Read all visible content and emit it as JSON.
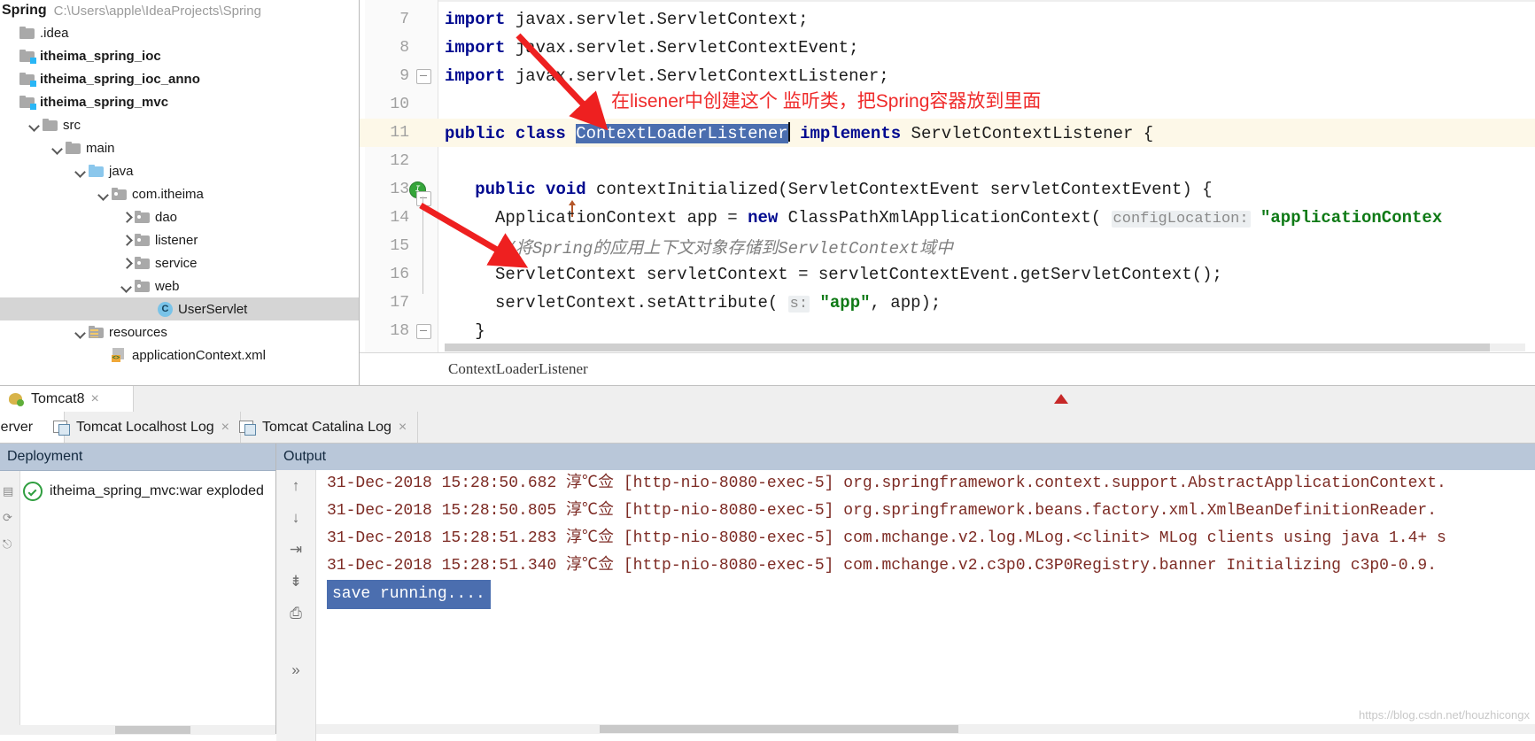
{
  "project": {
    "name": "Spring",
    "path": "C:\\Users\\apple\\IdeaProjects\\Spring",
    "tree": [
      {
        "label": ".idea",
        "indent": 0,
        "arrow": "none",
        "icon": "folder",
        "bold": false,
        "selected": false
      },
      {
        "label": "itheima_spring_ioc",
        "indent": 0,
        "arrow": "none",
        "icon": "module",
        "bold": true,
        "selected": false
      },
      {
        "label": "itheima_spring_ioc_anno",
        "indent": 0,
        "arrow": "none",
        "icon": "module",
        "bold": true,
        "selected": false
      },
      {
        "label": "itheima_spring_mvc",
        "indent": 0,
        "arrow": "none",
        "icon": "module",
        "bold": true,
        "selected": false
      },
      {
        "label": "src",
        "indent": 1,
        "arrow": "down",
        "icon": "folder",
        "bold": false,
        "selected": false
      },
      {
        "label": "main",
        "indent": 2,
        "arrow": "down",
        "icon": "folder",
        "bold": false,
        "selected": false
      },
      {
        "label": "java",
        "indent": 3,
        "arrow": "down",
        "icon": "folder-blue",
        "bold": false,
        "selected": false
      },
      {
        "label": "com.itheima",
        "indent": 4,
        "arrow": "down",
        "icon": "package",
        "bold": false,
        "selected": false
      },
      {
        "label": "dao",
        "indent": 5,
        "arrow": "right",
        "icon": "package",
        "bold": false,
        "selected": false
      },
      {
        "label": "listener",
        "indent": 5,
        "arrow": "right",
        "icon": "package",
        "bold": false,
        "selected": false
      },
      {
        "label": "service",
        "indent": 5,
        "arrow": "right",
        "icon": "package",
        "bold": false,
        "selected": false
      },
      {
        "label": "web",
        "indent": 5,
        "arrow": "down",
        "icon": "package",
        "bold": false,
        "selected": false
      },
      {
        "label": "UserServlet",
        "indent": 6,
        "arrow": "none",
        "icon": "class",
        "bold": false,
        "selected": true
      },
      {
        "label": "resources",
        "indent": 3,
        "arrow": "down",
        "icon": "resources",
        "bold": false,
        "selected": false
      },
      {
        "label": "applicationContext.xml",
        "indent": 4,
        "arrow": "none",
        "icon": "xml",
        "bold": false,
        "selected": false
      }
    ]
  },
  "editor": {
    "breadcrumb": "ContextLoaderListener",
    "selected_token": "ContextLoaderListener",
    "lines": [
      {
        "num": "7",
        "text": "import javax.servlet.ServletContext;"
      },
      {
        "num": "8",
        "text": "import javax.servlet.ServletContextEvent;"
      },
      {
        "num": "9",
        "text": "import javax.servlet.ServletContextListener;"
      },
      {
        "num": "10",
        "text": ""
      },
      {
        "num": "11",
        "text": "public class ContextLoaderListener implements ServletContextListener {"
      },
      {
        "num": "12",
        "text": ""
      },
      {
        "num": "13",
        "text": "    public void contextInitialized(ServletContextEvent servletContextEvent) {"
      },
      {
        "num": "14",
        "text": "        ApplicationContext app = new ClassPathXmlApplicationContext( configLocation: \"applicationContex"
      },
      {
        "num": "15",
        "text": "        //将Spring的应用上下文对象存储到ServletContext域中"
      },
      {
        "num": "16",
        "text": "        ServletContext servletContext = servletContextEvent.getServletContext();"
      },
      {
        "num": "17",
        "text": "        servletContext.setAttribute( s: \"app\", app);"
      },
      {
        "num": "18",
        "text": "    }"
      }
    ],
    "code_tokens": {
      "kw_import": "import",
      "kw_public": "public",
      "kw_class": "class",
      "kw_implements": "implements",
      "kw_void": "void",
      "kw_new": "new",
      "hint_configLocation": "configLocation:",
      "hint_s": "s:",
      "str_app": "\"app\"",
      "str_applicationContext": "\"applicationContex",
      "comment_line15": "//将Spring的应用上下文对象存储到ServletContext域中"
    }
  },
  "annotations": {
    "note_top": "在lisener中创建这个 监听类，把Spring容器放到里面",
    "color": "#ef2a2a"
  },
  "tool_window": {
    "run_tab": {
      "label": "Tomcat8",
      "close": "×"
    },
    "sub_tabs": [
      {
        "label": "Server",
        "active": true,
        "icon": "none",
        "close": ""
      },
      {
        "label": "Tomcat Localhost Log",
        "active": false,
        "icon": "window-icon",
        "close": "×"
      },
      {
        "label": "Tomcat Catalina Log",
        "active": false,
        "icon": "window-icon",
        "close": "×"
      }
    ],
    "deployment": {
      "title": "Deployment",
      "artifact": "itheima_spring_mvc:war exploded",
      "status_icon": "ok-check-icon"
    },
    "output": {
      "title": "Output",
      "toolbar_icons": [
        "arrow-up-icon",
        "arrow-down-icon",
        "soft-wrap-icon",
        "scroll-to-end-icon",
        "print-icon",
        "more-icon"
      ],
      "lines": [
        {
          "text": "31-Dec-2018 15:28:50.682 淳℃佥 [http-nio-8080-exec-5] org.springframework.context.support.AbstractApplicationContext.",
          "highlight": false
        },
        {
          "text": "31-Dec-2018 15:28:50.805 淳℃佥 [http-nio-8080-exec-5] org.springframework.beans.factory.xml.XmlBeanDefinitionReader. ",
          "highlight": false
        },
        {
          "text": "31-Dec-2018 15:28:51.283 淳℃佥 [http-nio-8080-exec-5] com.mchange.v2.log.MLog.<clinit> MLog clients using java 1.4+ s",
          "highlight": false
        },
        {
          "text": "31-Dec-2018 15:28:51.340 淳℃佥 [http-nio-8080-exec-5] com.mchange.v2.c3p0.C3P0Registry.banner Initializing c3p0-0.9. ",
          "highlight": false
        }
      ],
      "console_selected_text": "save running...."
    }
  },
  "watermark": "https://blog.csdn.net/houzhicongx"
}
